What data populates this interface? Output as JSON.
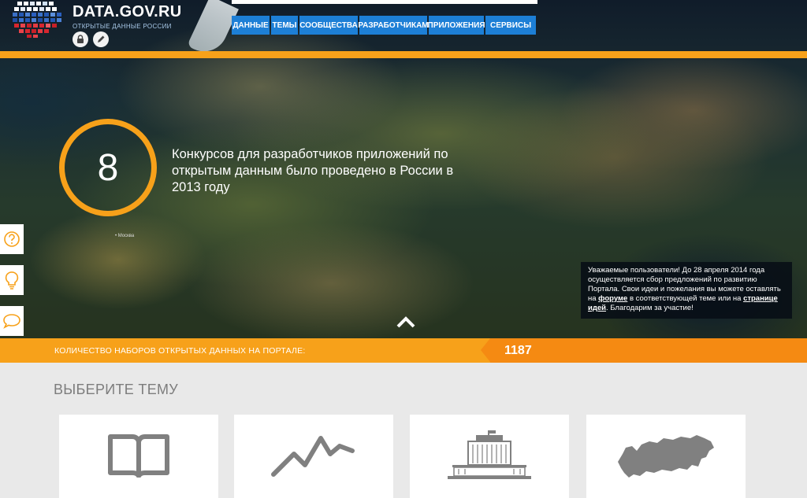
{
  "header": {
    "site_title": "DATA.GOV.RU",
    "site_subtitle": "открытые данные России"
  },
  "nav": {
    "items": [
      {
        "label": "Данные",
        "width": 48
      },
      {
        "label": "Темы",
        "width": 34
      },
      {
        "label": "Сообщества",
        "width": 74
      },
      {
        "label": "Разработчикам",
        "width": 86
      },
      {
        "label": "Приложения",
        "width": 70
      },
      {
        "label": "Сервисы",
        "width": 64
      }
    ]
  },
  "stat": {
    "number": "8",
    "text": "Конкурсов для разработчиков приложений по открытым данным было проведено в России в 2013 году"
  },
  "map": {
    "city_label": "• Москва"
  },
  "notice": {
    "text_before_forum": "Уважаемые пользователи! До 28 апреля 2014 года осуществляется сбор предложений по развитию Портала. Свои идеи и пожелания вы можете оставлять на ",
    "forum_link": "форуме",
    "text_middle": " в соответствующей теме или на ",
    "ideas_link": "странице идей",
    "text_after": ". Благодарим за участие!"
  },
  "counter": {
    "label": "Количество наборов открытых данных на портале:",
    "value": "1187"
  },
  "topics": {
    "title": "Выберите тему"
  },
  "icons": {
    "side": [
      "question-icon",
      "lightbulb-icon",
      "chat-bubble-icon"
    ],
    "header": [
      "lock-icon",
      "pencil-icon"
    ],
    "topics": [
      "book-icon",
      "line-chart-icon",
      "government-building-icon",
      "russia-map-icon"
    ]
  },
  "colors": {
    "accent": "#f7a11a",
    "accent_dark": "#f58a12",
    "nav_blue": "#1d7fd6",
    "topic_icon": "#808080"
  }
}
